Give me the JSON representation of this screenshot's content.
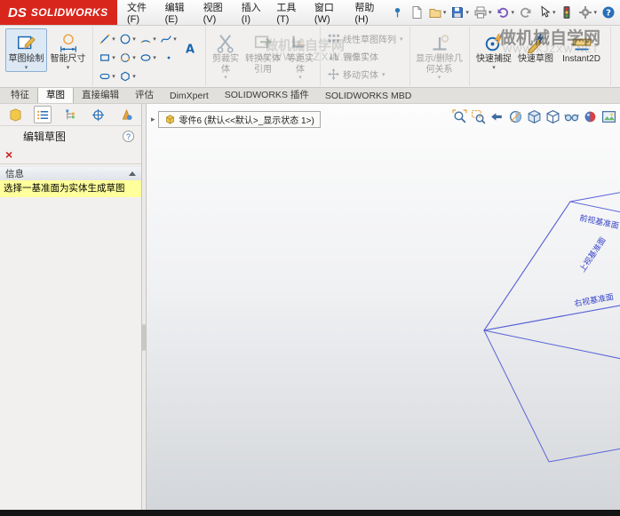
{
  "titlebar": {
    "logo": {
      "ds": "DS",
      "brand": "SOLIDWORKS"
    },
    "menus": [
      "文件(F)",
      "编辑(E)",
      "视图(V)",
      "插入(I)",
      "工具(T)",
      "窗口(W)",
      "帮助(H)"
    ]
  },
  "ribbon": {
    "sketch_draw": "草图绘制",
    "smart_dimension": "智能尺寸",
    "trim_entities": "剪裁实体",
    "convert_entities": "转换实体引用",
    "offset_entities": "等距实体",
    "linear_pattern": "线性草图阵列",
    "mirror_entities": "镜像实体",
    "move_entities": "移动实体",
    "display_delete_relations": "显示/删除几何关系",
    "quick_snaps": "快速捕捉",
    "rapid_sketch": "快速草图",
    "instant2d": "Instant2D"
  },
  "command_tabs": [
    "特征",
    "草图",
    "直接编辑",
    "评估",
    "DimXpert",
    "SOLIDWORKS 插件",
    "SOLIDWORKS MBD"
  ],
  "property_panel": {
    "title": "编辑草图",
    "info_header": "信息",
    "info_message": "选择一基准面为实体生成草图"
  },
  "viewport": {
    "document_tab": "零件6 (默认<<默认>_显示状态 1>)",
    "planes": {
      "front": "前视基准面",
      "top": "上视基准面",
      "right": "右视基准面"
    }
  },
  "watermark": {
    "name": "做机械自学网",
    "url": "WWW.KJZXW.NET"
  },
  "colors": {
    "brand_red": "#d9261c",
    "plane_blue": "#5a64d8",
    "message_yellow": "#ffff9c",
    "icon_blue": "#1a66b0",
    "icon_orange": "#e8a33d"
  }
}
